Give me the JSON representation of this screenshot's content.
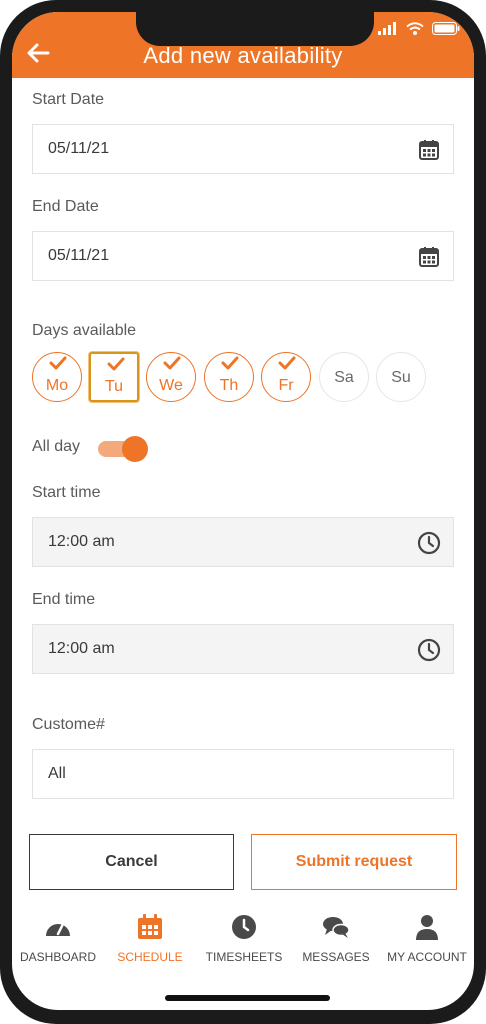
{
  "header": {
    "title": "Add new availability",
    "back_icon": "arrow-left-icon"
  },
  "form": {
    "start_date": {
      "label": "Start Date",
      "value": "05/11/21",
      "icon": "calendar-icon"
    },
    "end_date": {
      "label": "End Date",
      "value": "05/11/21",
      "icon": "calendar-icon"
    },
    "days_available": {
      "label": "Days available",
      "days": [
        {
          "label": "Mo",
          "selected": true
        },
        {
          "label": "Tu",
          "selected": true
        },
        {
          "label": "We",
          "selected": true
        },
        {
          "label": "Th",
          "selected": true
        },
        {
          "label": "Fr",
          "selected": true
        },
        {
          "label": "Sa",
          "selected": false
        },
        {
          "label": "Su",
          "selected": false
        }
      ]
    },
    "all_day": {
      "label": "All day",
      "on": true
    },
    "start_time": {
      "label": "Start time",
      "value": "12:00 am",
      "icon": "clock-icon"
    },
    "end_time": {
      "label": "End time",
      "value": "12:00 am",
      "icon": "clock-icon"
    },
    "customer": {
      "label": "Custome#",
      "value": "All"
    }
  },
  "actions": {
    "cancel": "Cancel",
    "submit": "Submit request"
  },
  "nav": [
    {
      "label": "DASHBOARD",
      "icon": "gauge-icon",
      "active": false
    },
    {
      "label": "SCHEDULE",
      "icon": "calendar-icon",
      "active": true
    },
    {
      "label": "TIMESHEETS",
      "icon": "clock-icon",
      "active": false
    },
    {
      "label": "MESSAGES",
      "icon": "chat-bubbles-icon",
      "active": false
    },
    {
      "label": "MY ACCOUNT",
      "icon": "user-icon",
      "active": false
    }
  ],
  "colors": {
    "accent": "#ee7427",
    "text": "#3a3a3a",
    "label": "#5a5a5a",
    "field_grey": "#f4f4f4"
  }
}
